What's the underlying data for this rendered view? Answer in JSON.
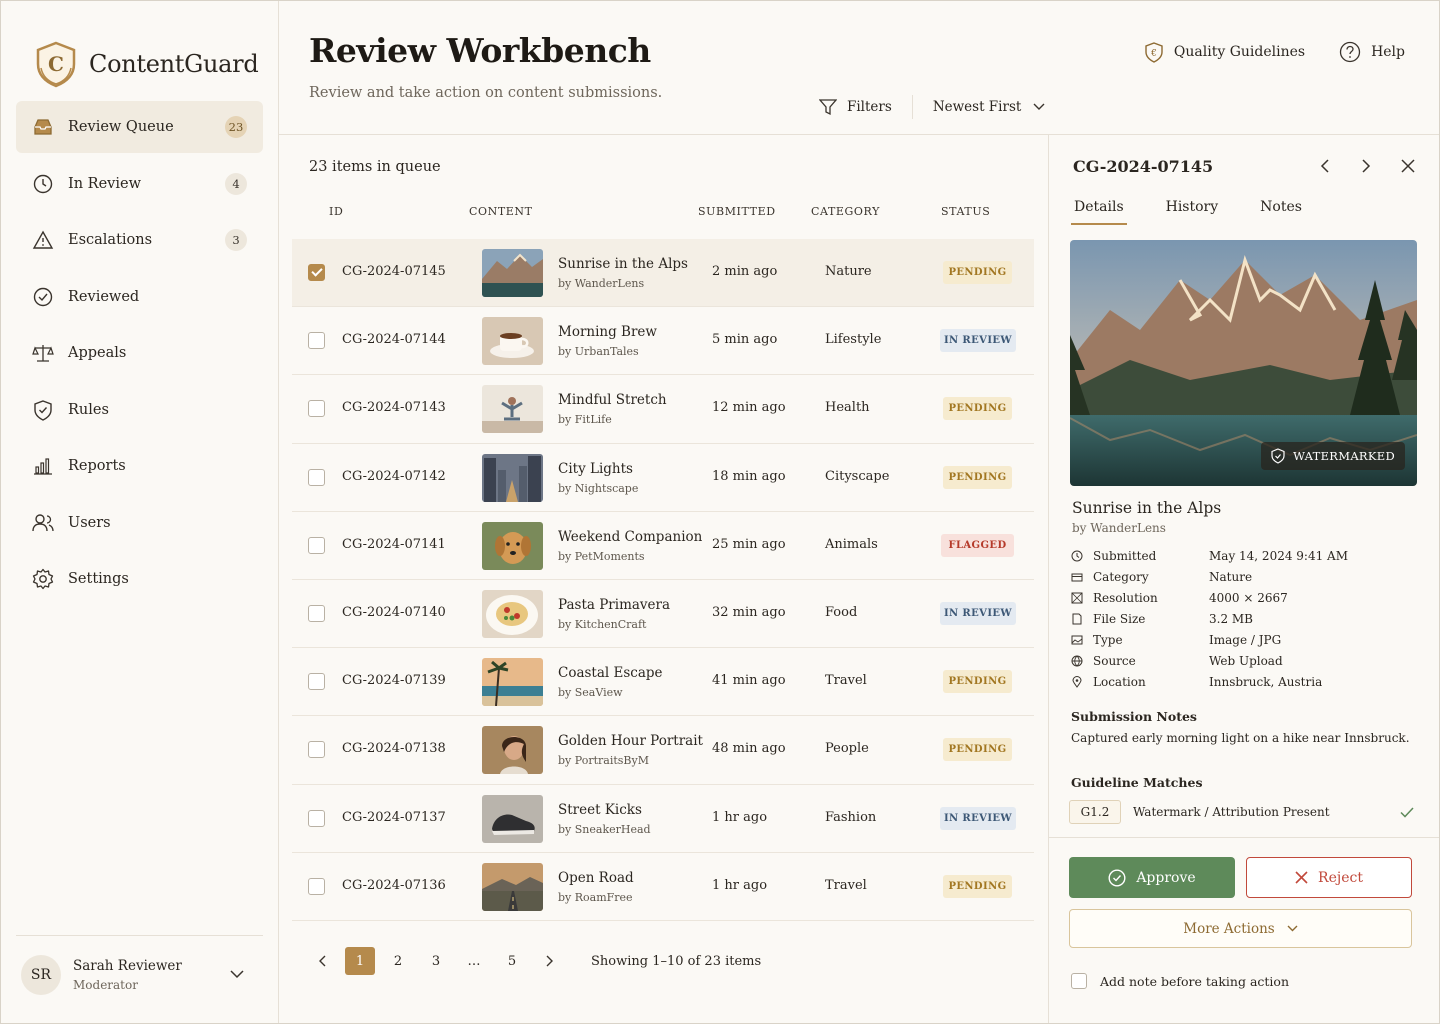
{
  "brand": {
    "name": "ContentGuard",
    "logo_letter": "C"
  },
  "sidebar": {
    "items": [
      {
        "label": "Review Queue",
        "count": "23",
        "icon": "inbox-icon",
        "active": true
      },
      {
        "label": "In Review",
        "count": "4",
        "icon": "clock-icon"
      },
      {
        "label": "Escalations",
        "count": "3",
        "icon": "warning-icon"
      },
      {
        "label": "Reviewed",
        "count": "",
        "icon": "check-circle-icon"
      },
      {
        "label": "Appeals",
        "count": "",
        "icon": "scales-icon"
      },
      {
        "label": "Rules",
        "count": "",
        "icon": "shield-icon"
      },
      {
        "label": "Reports",
        "count": "",
        "icon": "bar-chart-icon"
      },
      {
        "label": "Users",
        "count": "",
        "icon": "users-icon"
      },
      {
        "label": "Settings",
        "count": "",
        "icon": "gear-icon"
      }
    ],
    "user": {
      "initials": "SR",
      "name": "Sarah Reviewer",
      "role": "Moderator"
    }
  },
  "header": {
    "title": "Review Workbench",
    "subtitle": "Review and take action on content submissions.",
    "quality_label": "Quality Guidelines",
    "help_label": "Help",
    "filters_label": "Filters",
    "sort_label": "Newest First"
  },
  "queue": {
    "count_text": "23 items in queue",
    "columns": {
      "id": "ID",
      "content": "CONTENT",
      "submitted": "SUBMITTED",
      "category": "CATEGORY",
      "status": "STATUS"
    },
    "rows": [
      {
        "id": "CG-2024-07145",
        "title": "Sunrise in the Alps",
        "by": "by WanderLens",
        "submitted": "2 min ago",
        "category": "Nature",
        "status": "PENDING",
        "status_type": "pending",
        "checked": true,
        "thumb": "mountain"
      },
      {
        "id": "CG-2024-07144",
        "title": "Morning Brew",
        "by": "by UrbanTales",
        "submitted": "5 min ago",
        "category": "Lifestyle",
        "status": "IN REVIEW",
        "status_type": "review",
        "thumb": "coffee"
      },
      {
        "id": "CG-2024-07143",
        "title": "Mindful Stretch",
        "by": "by FitLife",
        "submitted": "12 min ago",
        "category": "Health",
        "status": "PENDING",
        "status_type": "pending",
        "thumb": "yoga"
      },
      {
        "id": "CG-2024-07142",
        "title": "City Lights",
        "by": "by Nightscape",
        "submitted": "18 min ago",
        "category": "Cityscape",
        "status": "PENDING",
        "status_type": "pending",
        "thumb": "city"
      },
      {
        "id": "CG-2024-07141",
        "title": "Weekend Companion",
        "by": "by PetMoments",
        "submitted": "25 min ago",
        "category": "Animals",
        "status": "FLAGGED",
        "status_type": "flagged",
        "thumb": "dog"
      },
      {
        "id": "CG-2024-07140",
        "title": "Pasta Primavera",
        "by": "by KitchenCraft",
        "submitted": "32 min ago",
        "category": "Food",
        "status": "IN REVIEW",
        "status_type": "review",
        "thumb": "pasta"
      },
      {
        "id": "CG-2024-07139",
        "title": "Coastal Escape",
        "by": "by SeaView",
        "submitted": "41 min ago",
        "category": "Travel",
        "status": "PENDING",
        "status_type": "pending",
        "thumb": "beach"
      },
      {
        "id": "CG-2024-07138",
        "title": "Golden Hour Portrait",
        "by": "by PortraitsByM",
        "submitted": "48 min ago",
        "category": "People",
        "status": "PENDING",
        "status_type": "pending",
        "thumb": "portrait"
      },
      {
        "id": "CG-2024-07137",
        "title": "Street Kicks",
        "by": "by SneakerHead",
        "submitted": "1 hr ago",
        "category": "Fashion",
        "status": "IN REVIEW",
        "status_type": "review",
        "thumb": "shoe"
      },
      {
        "id": "CG-2024-07136",
        "title": "Open Road",
        "by": "by RoamFree",
        "submitted": "1 hr ago",
        "category": "Travel",
        "status": "PENDING",
        "status_type": "pending",
        "thumb": "road"
      }
    ],
    "pagination": {
      "pages": [
        "1",
        "2",
        "3",
        "…",
        "5"
      ],
      "current": "1",
      "info": "Showing 1–10 of 23 items"
    }
  },
  "detail": {
    "id": "CG-2024-07145",
    "tabs": [
      "Details",
      "History",
      "Notes"
    ],
    "watermark_label": "WATERMARKED",
    "title": "Sunrise in the Alps",
    "by": "by WanderLens",
    "meta": [
      {
        "key": "Submitted",
        "value": "May 14, 2024 9:41 AM",
        "icon": "clock-icon"
      },
      {
        "key": "Category",
        "value": "Nature",
        "icon": "tag-icon"
      },
      {
        "key": "Resolution",
        "value": "4000 × 2667",
        "icon": "image-icon"
      },
      {
        "key": "File Size",
        "value": "3.2 MB",
        "icon": "file-icon"
      },
      {
        "key": "Type",
        "value": "Image / JPG",
        "icon": "photo-icon"
      },
      {
        "key": "Source",
        "value": "Web Upload",
        "icon": "globe-icon"
      },
      {
        "key": "Location",
        "value": "Innsbruck, Austria",
        "icon": "pin-icon"
      }
    ],
    "notes_title": "Submission Notes",
    "notes_text": "Captured early morning light on a hike near Innsbruck.",
    "guidelines_title": "Guideline Matches",
    "guideline": {
      "code": "G1.2",
      "text": "Watermark / Attribution Present"
    },
    "approve_label": "Approve",
    "reject_label": "Reject",
    "more_label": "More Actions",
    "add_note_label": "Add note before taking action"
  },
  "colors": {
    "accent": "#b58a4c",
    "approve": "#5e8a5a",
    "reject": "#c1493b",
    "background": "#fbf9f5"
  }
}
